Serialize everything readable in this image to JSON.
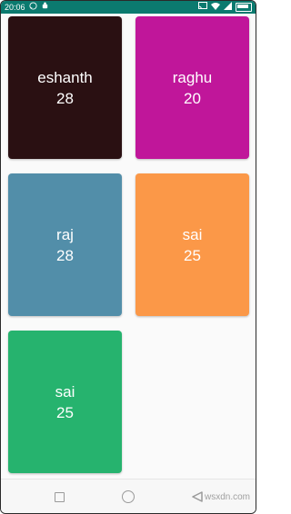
{
  "status_bar": {
    "time": "20:06",
    "background": "#0b7a6f",
    "left_icons": [
      "whatsapp-icon",
      "android-debug-icon"
    ],
    "right_icons": [
      "cast-icon",
      "wifi-icon",
      "signal-icon",
      "battery-icon"
    ]
  },
  "cards": [
    {
      "name": "eshanth",
      "age": "28",
      "color": "#2a1012"
    },
    {
      "name": "raghu",
      "age": "20",
      "color": "#c0169a"
    },
    {
      "name": "raj",
      "age": "28",
      "color": "#528ea9"
    },
    {
      "name": "sai",
      "age": "25",
      "color": "#fb9848"
    },
    {
      "name": "sai",
      "age": "25",
      "color": "#26b36e"
    }
  ],
  "nav_bar": {
    "icons": [
      "recents-square-icon",
      "home-circle-icon",
      "back-triangle-icon"
    ],
    "watermark": "wsxdn.com"
  }
}
